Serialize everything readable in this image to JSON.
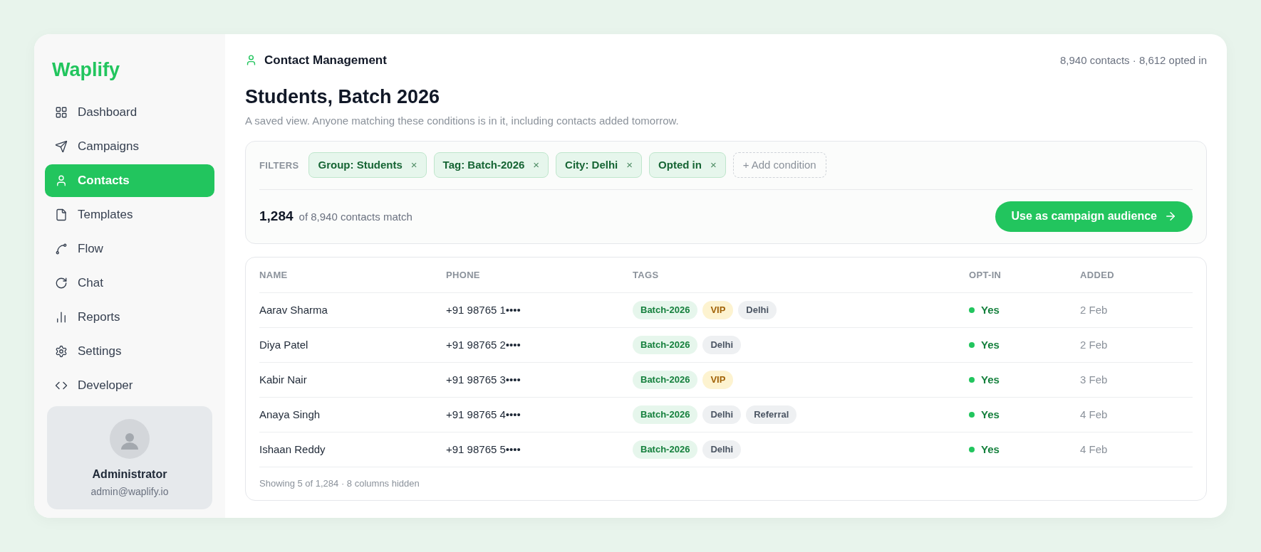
{
  "brand": "Waplify",
  "nav": [
    {
      "label": "Dashboard",
      "selected": false
    },
    {
      "label": "Campaigns",
      "selected": false
    },
    {
      "label": "Contacts",
      "selected": true
    },
    {
      "label": "Templates",
      "selected": false
    },
    {
      "label": "Flow",
      "selected": false
    },
    {
      "label": "Chat",
      "selected": false
    },
    {
      "label": "Reports",
      "selected": false
    },
    {
      "label": "Settings",
      "selected": false
    },
    {
      "label": "Developer",
      "selected": false
    }
  ],
  "user": {
    "name": "Administrator",
    "email": "admin@waplify.io"
  },
  "header": {
    "section": "Contact Management",
    "stats": "8,940 contacts · 8,612 opted in"
  },
  "title": "Students, Batch 2026",
  "subtitle": "A saved view. Anyone matching these conditions is in it, including contacts added tomorrow.",
  "filters": {
    "label": "FILTERS",
    "chips": [
      {
        "label": "Group: Students",
        "remove": "×"
      },
      {
        "label": "Tag: Batch-2026",
        "remove": "×"
      },
      {
        "label": "City: Delhi",
        "remove": "×"
      },
      {
        "label": "Opted in",
        "remove": "×"
      }
    ],
    "add": "+ Add condition"
  },
  "match": {
    "count": "1,284",
    "text": "of 8,940 contacts match",
    "button": "Use as campaign audience"
  },
  "table": {
    "columns": [
      "NAME",
      "PHONE",
      "TAGS",
      "OPT-IN",
      "ADDED"
    ],
    "rows": [
      {
        "name": "Aarav Sharma",
        "phone": "+91 98765 1••••",
        "tags": [
          {
            "label": "Batch-2026",
            "kind": "green"
          },
          {
            "label": "VIP",
            "kind": "amber"
          },
          {
            "label": "Delhi",
            "kind": "gray"
          }
        ],
        "optin": "Yes",
        "opted_in": true,
        "added": "2 Feb"
      },
      {
        "name": "Diya Patel",
        "phone": "+91 98765 2••••",
        "tags": [
          {
            "label": "Batch-2026",
            "kind": "green"
          },
          {
            "label": "Delhi",
            "kind": "gray"
          }
        ],
        "optin": "Yes",
        "opted_in": true,
        "added": "2 Feb"
      },
      {
        "name": "Kabir Nair",
        "phone": "+91 98765 3••••",
        "tags": [
          {
            "label": "Batch-2026",
            "kind": "green"
          },
          {
            "label": "VIP",
            "kind": "amber"
          }
        ],
        "optin": "Yes",
        "opted_in": true,
        "added": "3 Feb"
      },
      {
        "name": "Anaya Singh",
        "phone": "+91 98765 4••••",
        "tags": [
          {
            "label": "Batch-2026",
            "kind": "green"
          },
          {
            "label": "Delhi",
            "kind": "gray"
          },
          {
            "label": "Referral",
            "kind": "gray"
          }
        ],
        "optin": "Yes",
        "opted_in": true,
        "added": "4 Feb"
      },
      {
        "name": "Ishaan Reddy",
        "phone": "+91 98765 5••••",
        "tags": [
          {
            "label": "Batch-2026",
            "kind": "green"
          },
          {
            "label": "Delhi",
            "kind": "gray"
          }
        ],
        "optin": "Yes",
        "opted_in": true,
        "added": "4 Feb"
      }
    ],
    "footer": "Showing 5 of 1,284 · 8 columns hidden"
  }
}
